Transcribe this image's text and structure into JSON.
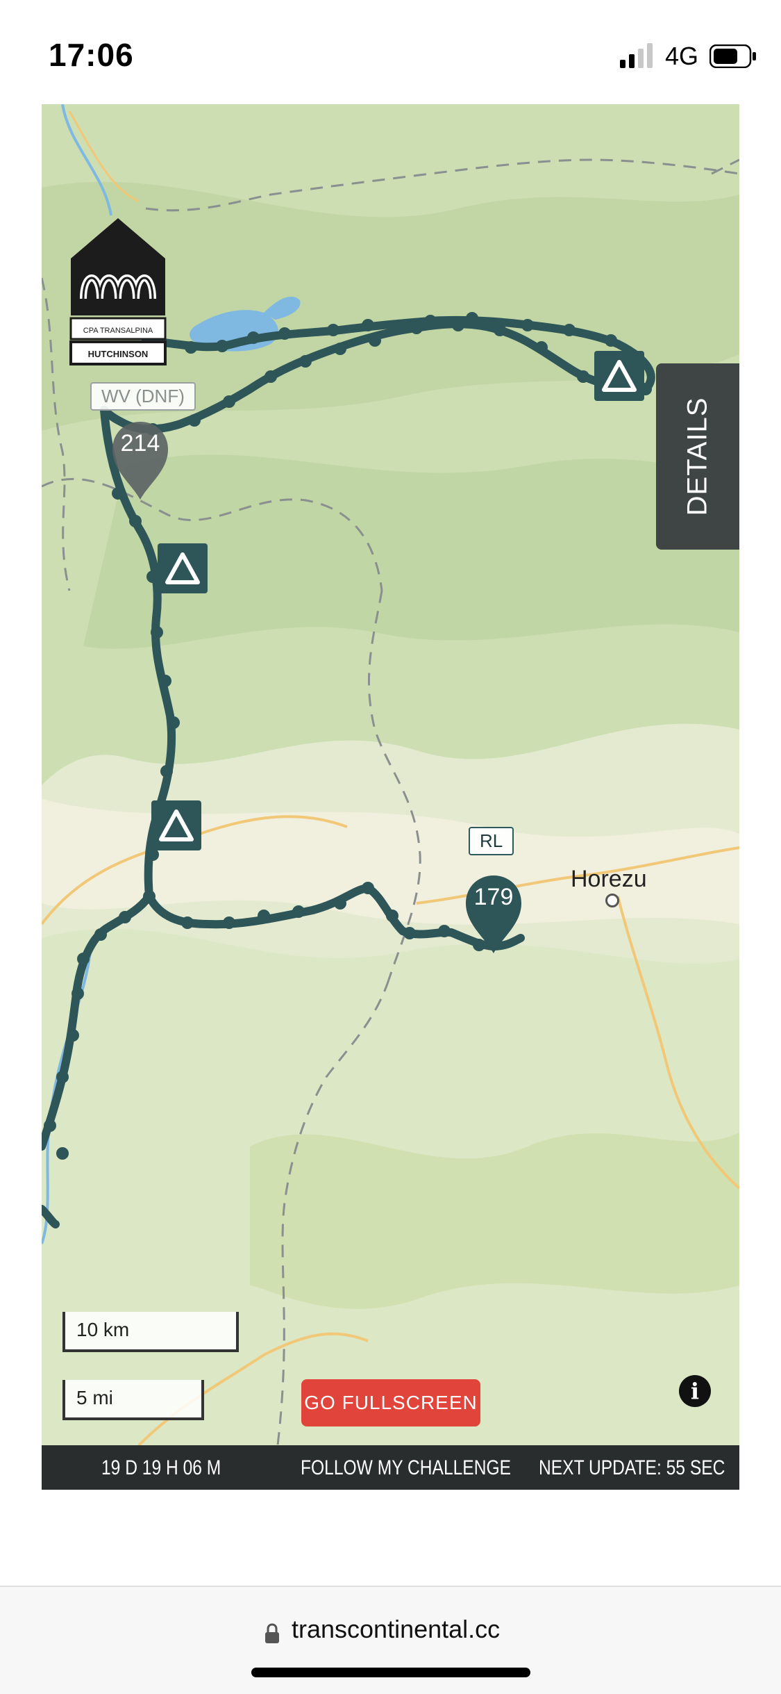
{
  "status_bar": {
    "time": "17:06",
    "network": "4G"
  },
  "map": {
    "labels": {
      "wv": "WV (DNF)",
      "rl": "RL"
    },
    "pins": [
      {
        "number": "214",
        "color": "#5a6263"
      },
      {
        "number": "179",
        "color": "#2e5558"
      }
    ],
    "town": "Horezu",
    "details_tab": "DETAILS",
    "scale": {
      "km": "10 km",
      "mi": "5 mi"
    },
    "fullscreen_button": "GO FULLSCREEN",
    "info_icon": "i",
    "logo_text": {
      "line1": "CPA TRANSALPINA",
      "line2": "HUTCHINSON"
    },
    "route_color": "#2e5558",
    "icons": [
      "camp-tent-icon",
      "info-icon"
    ]
  },
  "bottom_bar": {
    "elapsed": "19 D 19 H 06 M",
    "follow": "FOLLOW MY CHALLENGE",
    "next_update": "NEXT UPDATE: 55 SEC"
  },
  "browser": {
    "url": "transcontinental.cc"
  }
}
